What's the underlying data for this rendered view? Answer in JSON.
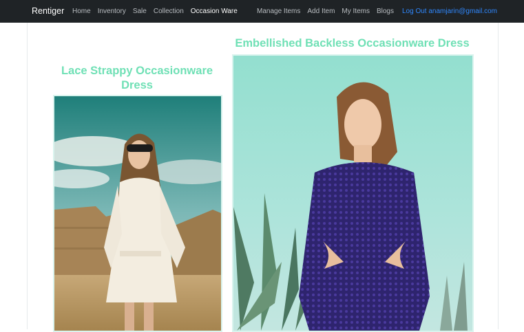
{
  "nav": {
    "brand": "Rentiger",
    "left_items": [
      "Home",
      "Inventory",
      "Sale",
      "Collection",
      "Occasion Ware"
    ],
    "right_items": [
      "Manage Items",
      "Add Item",
      "My Items",
      "Blogs"
    ],
    "logout": "Log Out anamjarin@gmail.com"
  },
  "products": [
    {
      "title": "Lace Strappy Occasionware Dress"
    },
    {
      "title": "Embellished Backless Occasionware Dress"
    }
  ],
  "colors": {
    "navbar": "#1f2326",
    "accent_title": "#6fe0b5",
    "logout_link": "#2f88ff"
  }
}
